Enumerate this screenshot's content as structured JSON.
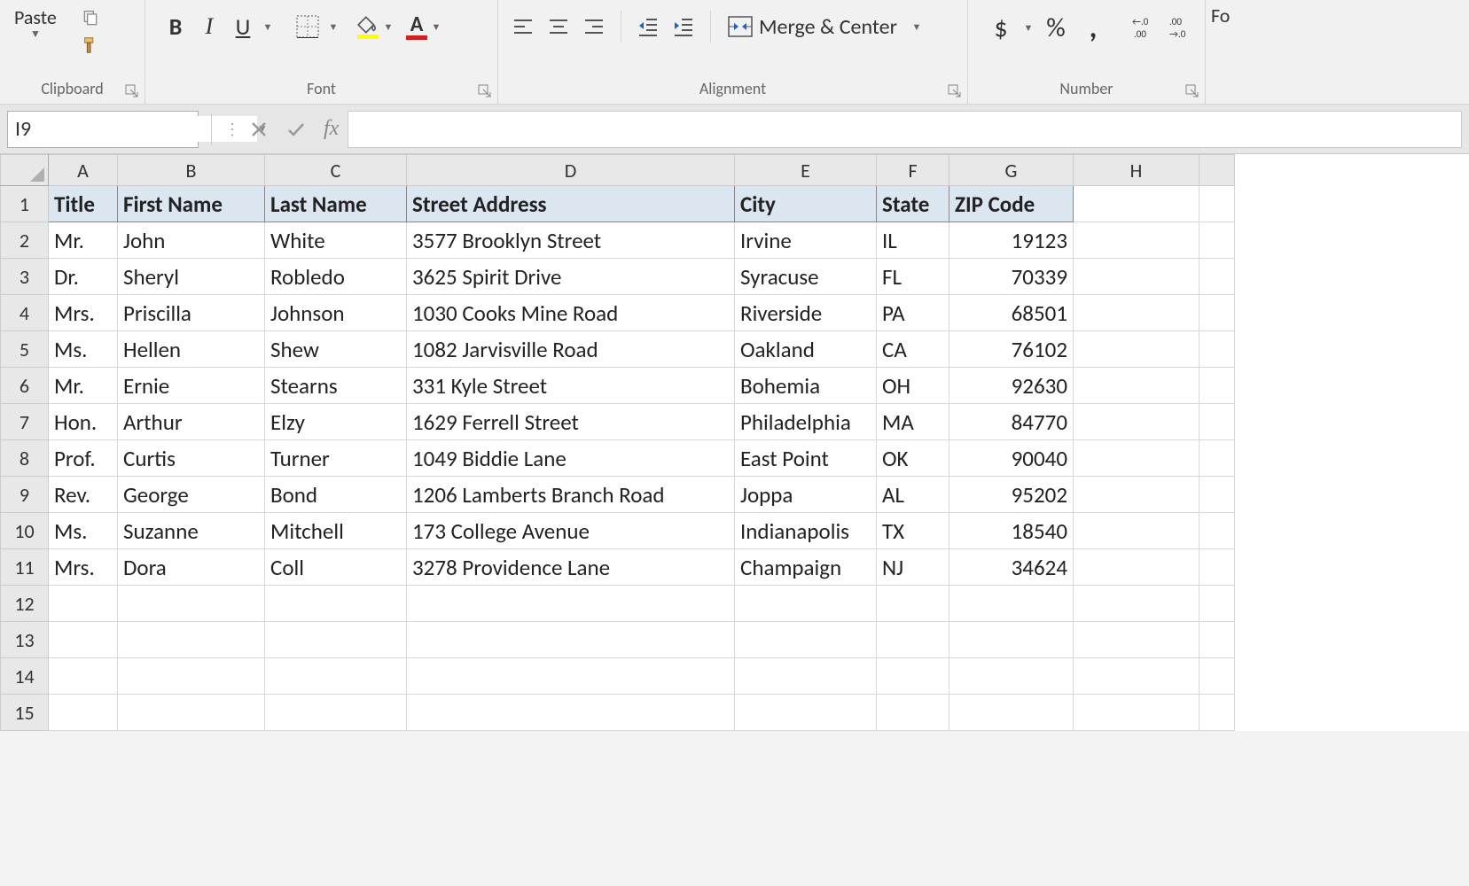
{
  "ribbon": {
    "clipboard": {
      "paste": "Paste",
      "label": "Clipboard"
    },
    "font": {
      "label": "Font",
      "bold": "B",
      "italic": "I",
      "underline": "U"
    },
    "alignment": {
      "label": "Alignment",
      "merge": "Merge & Center"
    },
    "number": {
      "label": "Number",
      "currency": "$",
      "percent": "%",
      "comma": ","
    },
    "edge": "Fo"
  },
  "formulaBar": {
    "nameBox": "I9",
    "fx": "fx",
    "formula": ""
  },
  "columns": [
    "A",
    "B",
    "C",
    "D",
    "E",
    "F",
    "G",
    "H"
  ],
  "rowNumbers": [
    1,
    2,
    3,
    4,
    5,
    6,
    7,
    8,
    9,
    10,
    11,
    12,
    13,
    14,
    15
  ],
  "headers": [
    "Title",
    "First Name",
    "Last Name",
    "Street Address",
    "City",
    "State",
    "ZIP Code"
  ],
  "rows": [
    {
      "title": "Mr.",
      "first": "John",
      "last": "White",
      "street": "3577 Brooklyn Street",
      "city": "Irvine",
      "state": "IL",
      "zip": "19123"
    },
    {
      "title": "Dr.",
      "first": "Sheryl",
      "last": "Robledo",
      "street": "3625 Spirit Drive",
      "city": "Syracuse",
      "state": "FL",
      "zip": "70339"
    },
    {
      "title": "Mrs.",
      "first": "Priscilla",
      "last": "Johnson",
      "street": "1030 Cooks Mine Road",
      "city": "Riverside",
      "state": "PA",
      "zip": "68501"
    },
    {
      "title": "Ms.",
      "first": "Hellen",
      "last": "Shew",
      "street": "1082 Jarvisville Road",
      "city": "Oakland",
      "state": "CA",
      "zip": "76102"
    },
    {
      "title": "Mr.",
      "first": "Ernie",
      "last": "Stearns",
      "street": "331 Kyle Street",
      "city": "Bohemia",
      "state": "OH",
      "zip": "92630"
    },
    {
      "title": "Hon.",
      "first": "Arthur",
      "last": "Elzy",
      "street": "1629 Ferrell Street",
      "city": "Philadelphia",
      "state": "MA",
      "zip": "84770"
    },
    {
      "title": "Prof.",
      "first": "Curtis",
      "last": "Turner",
      "street": "1049 Biddie Lane",
      "city": "East Point",
      "state": "OK",
      "zip": "90040"
    },
    {
      "title": "Rev.",
      "first": "George",
      "last": "Bond",
      "street": "1206 Lamberts Branch Road",
      "city": "Joppa",
      "state": "AL",
      "zip": "95202"
    },
    {
      "title": "Ms.",
      "first": "Suzanne",
      "last": "Mitchell",
      "street": "173 College Avenue",
      "city": "Indianapolis",
      "state": "TX",
      "zip": "18540"
    },
    {
      "title": "Mrs.",
      "first": "Dora",
      "last": "Coll",
      "street": "3278 Providence Lane",
      "city": "Champaign",
      "state": "NJ",
      "zip": "34624"
    }
  ],
  "chart_data": {
    "type": "table",
    "title": "Address List",
    "columns": [
      "Title",
      "First Name",
      "Last Name",
      "Street Address",
      "City",
      "State",
      "ZIP Code"
    ],
    "data": [
      [
        "Mr.",
        "John",
        "White",
        "3577 Brooklyn Street",
        "Irvine",
        "IL",
        19123
      ],
      [
        "Dr.",
        "Sheryl",
        "Robledo",
        "3625 Spirit Drive",
        "Syracuse",
        "FL",
        70339
      ],
      [
        "Mrs.",
        "Priscilla",
        "Johnson",
        "1030 Cooks Mine Road",
        "Riverside",
        "PA",
        68501
      ],
      [
        "Ms.",
        "Hellen",
        "Shew",
        "1082 Jarvisville Road",
        "Oakland",
        "CA",
        76102
      ],
      [
        "Mr.",
        "Ernie",
        "Stearns",
        "331 Kyle Street",
        "Bohemia",
        "OH",
        92630
      ],
      [
        "Hon.",
        "Arthur",
        "Elzy",
        "1629 Ferrell Street",
        "Philadelphia",
        "MA",
        84770
      ],
      [
        "Prof.",
        "Curtis",
        "Turner",
        "1049 Biddie Lane",
        "East Point",
        "OK",
        90040
      ],
      [
        "Rev.",
        "George",
        "Bond",
        "1206 Lamberts Branch Road",
        "Joppa",
        "AL",
        95202
      ],
      [
        "Ms.",
        "Suzanne",
        "Mitchell",
        "173 College Avenue",
        "Indianapolis",
        "TX",
        18540
      ],
      [
        "Mrs.",
        "Dora",
        "Coll",
        "3278 Providence Lane",
        "Champaign",
        "NJ",
        34624
      ]
    ]
  }
}
